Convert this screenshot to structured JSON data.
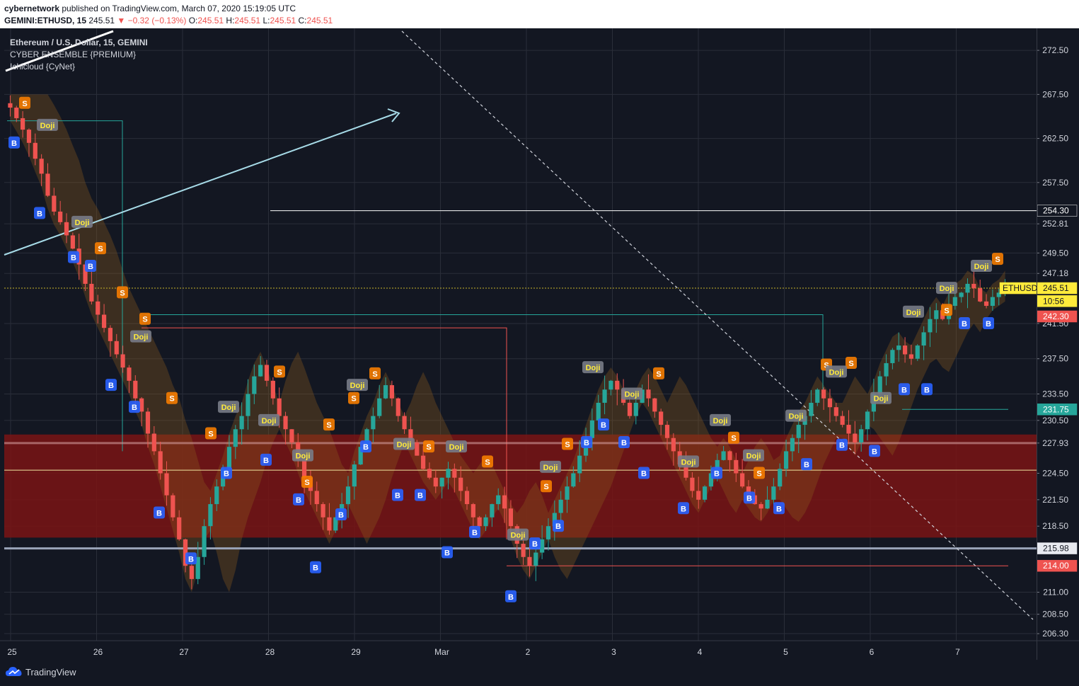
{
  "header": {
    "author": "cybernetwork",
    "published_text": "published on TradingView.com, March 07, 2020 15:19:05 UTC",
    "symbol_code": "GEMINI:ETHUSD, 15",
    "last": "245.51",
    "change": "▼ −0.32 (−0.13%)",
    "o_label": "O:",
    "o": "245.51",
    "h_label": "H:",
    "h": "245.51",
    "l_label": "L:",
    "l": "245.51",
    "c_label": "C:",
    "c": "245.51"
  },
  "legend": {
    "symbol_title": "Ethereum / U.S. Dollar, 15, GEMINI",
    "indicator1": "CYBER ENSEMBLE {PREMIUM}",
    "indicator2": "Ichicloud {CyNet}"
  },
  "footer": {
    "brand": "TradingView"
  },
  "colors": {
    "background": "#131722",
    "grid": "#2a2e39",
    "up": "#26a69a",
    "down": "#ef5350",
    "buy_badge": "#2962ff",
    "sell_badge": "#f57c00",
    "doji_badge": "#787b86",
    "zone": "#7a1414",
    "price_label": "#ffeb3b"
  },
  "chart_data": {
    "type": "candlestick",
    "x_ticks": [
      "25",
      "26",
      "27",
      "28",
      "29",
      "Mar",
      "2",
      "3",
      "4",
      "5",
      "6",
      "7"
    ],
    "y_ticks": [
      272.5,
      267.5,
      262.5,
      257.5,
      252.81,
      249.5,
      247.18,
      241.5,
      237.5,
      233.5,
      230.5,
      227.93,
      224.5,
      221.5,
      218.5,
      211.0,
      208.5,
      206.3
    ],
    "ylim": [
      205.5,
      275.0
    ],
    "price_labels": [
      {
        "text": "254.30",
        "value": 254.3,
        "style": "dark"
      },
      {
        "text": "ETHUSD",
        "value": 245.51,
        "style": "yellow"
      },
      {
        "text": "245.51",
        "value": 245.51,
        "style": "yellow"
      },
      {
        "text": "10:56",
        "value": 244.2,
        "style": "yellow"
      },
      {
        "text": "242.30",
        "value": 242.3,
        "style": "red"
      },
      {
        "text": "231.75",
        "value": 231.75,
        "style": "green"
      },
      {
        "text": "215.98",
        "value": 215.98,
        "style": "white"
      },
      {
        "text": "214.00",
        "value": 214.0,
        "style": "red"
      }
    ],
    "levels": [
      {
        "value": 254.3,
        "color": "#ffffff"
      },
      {
        "value": 245.51,
        "color": "#c9b42a",
        "dashed": true
      },
      {
        "value": 224.85,
        "color": "#f0e6a0"
      },
      {
        "value": 215.98,
        "color": "#9aa4b8"
      },
      {
        "value": 227.93,
        "color": "#d09a9a"
      }
    ],
    "zone": {
      "low": 217.2,
      "high": 228.9
    },
    "signal_markers": {
      "buy": "B",
      "sell": "S",
      "doji": "Doji"
    },
    "candles_close": [
      266.0,
      264.8,
      263.5,
      262.0,
      260.2,
      258.5,
      256.0,
      254.2,
      253.0,
      251.5,
      250.0,
      248.2,
      246.0,
      244.0,
      242.5,
      241.0,
      239.5,
      238.0,
      236.5,
      235.0,
      233.0,
      231.5,
      229.0,
      227.0,
      224.5,
      222.0,
      219.5,
      217.0,
      214.0,
      212.5,
      215.0,
      218.5,
      221.0,
      223.0,
      225.0,
      227.5,
      229.5,
      231.0,
      233.5,
      235.5,
      236.8,
      235.0,
      233.0,
      231.0,
      229.5,
      228.0,
      226.0,
      224.0,
      222.5,
      221.0,
      219.5,
      218.0,
      219.5,
      221.0,
      223.0,
      225.5,
      227.5,
      229.5,
      231.0,
      233.0,
      234.5,
      233.0,
      231.0,
      229.5,
      228.0,
      226.5,
      225.0,
      224.0,
      223.0,
      224.0,
      225.0,
      224.0,
      222.5,
      221.0,
      219.5,
      218.5,
      219.5,
      221.0,
      222.0,
      220.5,
      218.5,
      216.5,
      215.0,
      214.0,
      215.5,
      217.0,
      218.5,
      220.0,
      221.5,
      223.0,
      224.5,
      226.5,
      228.5,
      230.5,
      232.5,
      234.0,
      235.0,
      234.0,
      232.5,
      231.0,
      232.5,
      234.0,
      233.0,
      231.5,
      230.0,
      228.5,
      227.0,
      225.5,
      224.0,
      222.5,
      221.5,
      223.0,
      224.5,
      226.0,
      227.0,
      226.0,
      224.5,
      223.0,
      222.0,
      221.0,
      220.5,
      221.5,
      223.0,
      225.0,
      227.0,
      228.5,
      230.0,
      231.0,
      232.5,
      234.0,
      233.0,
      232.0,
      231.0,
      230.0,
      229.0,
      228.0,
      229.5,
      231.5,
      233.5,
      235.5,
      237.0,
      238.5,
      239.0,
      238.0,
      237.5,
      239.0,
      240.5,
      242.0,
      243.0,
      242.0,
      243.5,
      244.5,
      245.0,
      246.0,
      245.5,
      244.0,
      243.5,
      244.5,
      245.0,
      245.51
    ]
  }
}
